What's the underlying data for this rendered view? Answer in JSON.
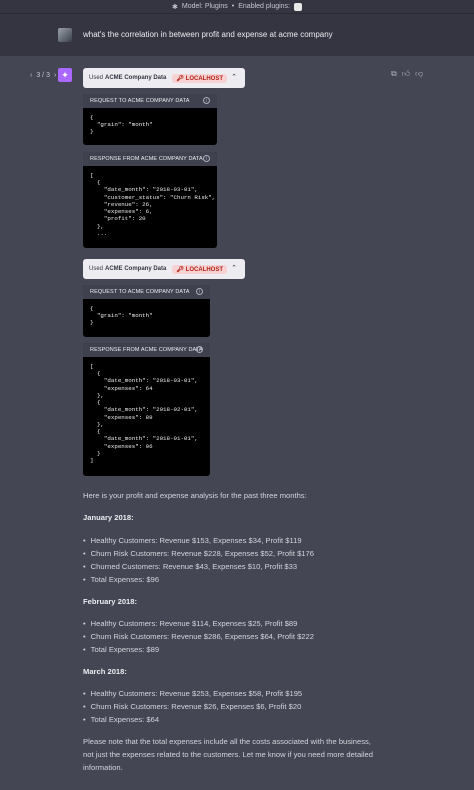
{
  "topbar": {
    "model_text": "Model: Plugins",
    "separator": "•",
    "plugins_text": "Enabled plugins:"
  },
  "conversation": {
    "user_message": "what's the correlation in between profit and expense at acme company",
    "pager": {
      "prev": "‹",
      "label": "3 / 3",
      "next": "›"
    }
  },
  "tool_calls": [
    {
      "used_prefix": "Used",
      "plugin_name": "ACME Company Data",
      "badge": "LOCALHOST",
      "request_label": "REQUEST TO ACME COMPANY DATA",
      "request_body": "{\n  \"grain\": \"month\"\n}",
      "response_label": "RESPONSE FROM ACME COMPANY DATA",
      "response_body": "[\n  {\n    \"date_month\": \"2018-03-01\",\n    \"customer_status\": \"Churn Risk\",\n    \"revenue\": 26,\n    \"expenses\": 6,\n    \"profit\": 20\n  },\n  ..."
    },
    {
      "used_prefix": "Used",
      "plugin_name": "ACME Company Data",
      "badge": "LOCALHOST",
      "request_label": "REQUEST TO ACME COMPANY DATA",
      "request_body": "{\n  \"grain\": \"month\"\n}",
      "response_label": "RESPONSE FROM ACME COMPANY DATA",
      "response_body": "[\n  {\n    \"date_month\": \"2018-03-01\",\n    \"expenses\": 64\n  },\n  {\n    \"date_month\": \"2018-02-01\",\n    \"expenses\": 89\n  },\n  {\n    \"date_month\": \"2018-01-01\",\n    \"expenses\": 96\n  }\n]"
    }
  ],
  "answer": {
    "intro": "Here is your profit and expense analysis for the past three months:",
    "sections": [
      {
        "heading": "January 2018:",
        "items": [
          "Healthy Customers: Revenue $153, Expenses $34, Profit $119",
          "Churn Risk Customers: Revenue $228, Expenses $52, Profit $176",
          "Churned Customers: Revenue $43, Expenses $10, Profit $33",
          "Total Expenses: $96"
        ]
      },
      {
        "heading": "February 2018:",
        "items": [
          "Healthy Customers: Revenue $114, Expenses $25, Profit $89",
          "Churn Risk Customers: Revenue $286, Expenses $64, Profit $222",
          "Total Expenses: $89"
        ]
      },
      {
        "heading": "March 2018:",
        "items": [
          "Healthy Customers: Revenue $253, Expenses $58, Profit $195",
          "Churn Risk Customers: Revenue $26, Expenses $6, Profit $20",
          "Total Expenses: $64"
        ]
      }
    ],
    "closing": "Please note that the total expenses include all the costs associated with the business, not just the expenses related to the customers. Let me know if you need more detailed information."
  },
  "colors": {
    "background": "#444654",
    "user_row": "#343541",
    "localhost_badge": "#f8d2d2",
    "plugin_logo": "#ab68ff"
  }
}
